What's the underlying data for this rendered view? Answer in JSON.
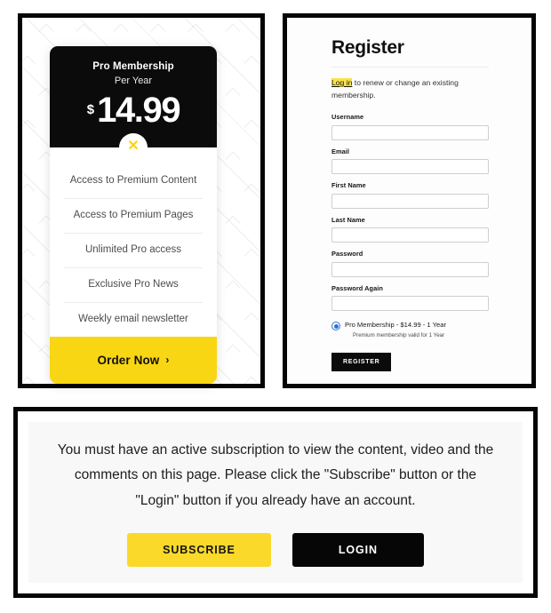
{
  "pricing_card": {
    "plan_name": "Pro Membership",
    "period": "Per Year",
    "currency_symbol": "$",
    "amount": "14.99",
    "badge_icon": "close-x-icon",
    "badge_glyph": "✕",
    "features": [
      "Access to Premium Content",
      "Access to Premium Pages",
      "Unlimited Pro access",
      "Exclusive Pro News",
      "Weekly email newsletter"
    ],
    "order_button_label": "Order Now",
    "order_button_chevron": "›",
    "accent_color": "#f9d614",
    "header_bg": "#0b0b0b"
  },
  "register": {
    "title": "Register",
    "intro_link": "Log in",
    "intro_rest": " to renew or change an existing membership.",
    "fields": [
      {
        "label": "Username",
        "value": "",
        "placeholder": ""
      },
      {
        "label": "Email",
        "value": "",
        "placeholder": ""
      },
      {
        "label": "First Name",
        "value": "",
        "placeholder": ""
      },
      {
        "label": "Last Name",
        "value": "",
        "placeholder": ""
      },
      {
        "label": "Password",
        "value": "",
        "placeholder": ""
      },
      {
        "label": "Password Again",
        "value": "",
        "placeholder": ""
      }
    ],
    "plan_option": {
      "label": "Pro Membership - $14.99 -  1 Year",
      "description": "Premium membership valid for 1 Year",
      "selected": true,
      "radio_color": "#2a72d4"
    },
    "submit_label": "REGISTER",
    "highlight_color": "#fbe24a"
  },
  "notice": {
    "message": "You must have an active subscription to view the content, video and the comments on this page. Please click the \"Subscribe\" button or the \"Login\" button if you already have an account.",
    "subscribe_label": "SUBSCRIBE",
    "login_label": "LOGIN",
    "subscribe_color": "#fbd92a",
    "login_color": "#060606"
  }
}
